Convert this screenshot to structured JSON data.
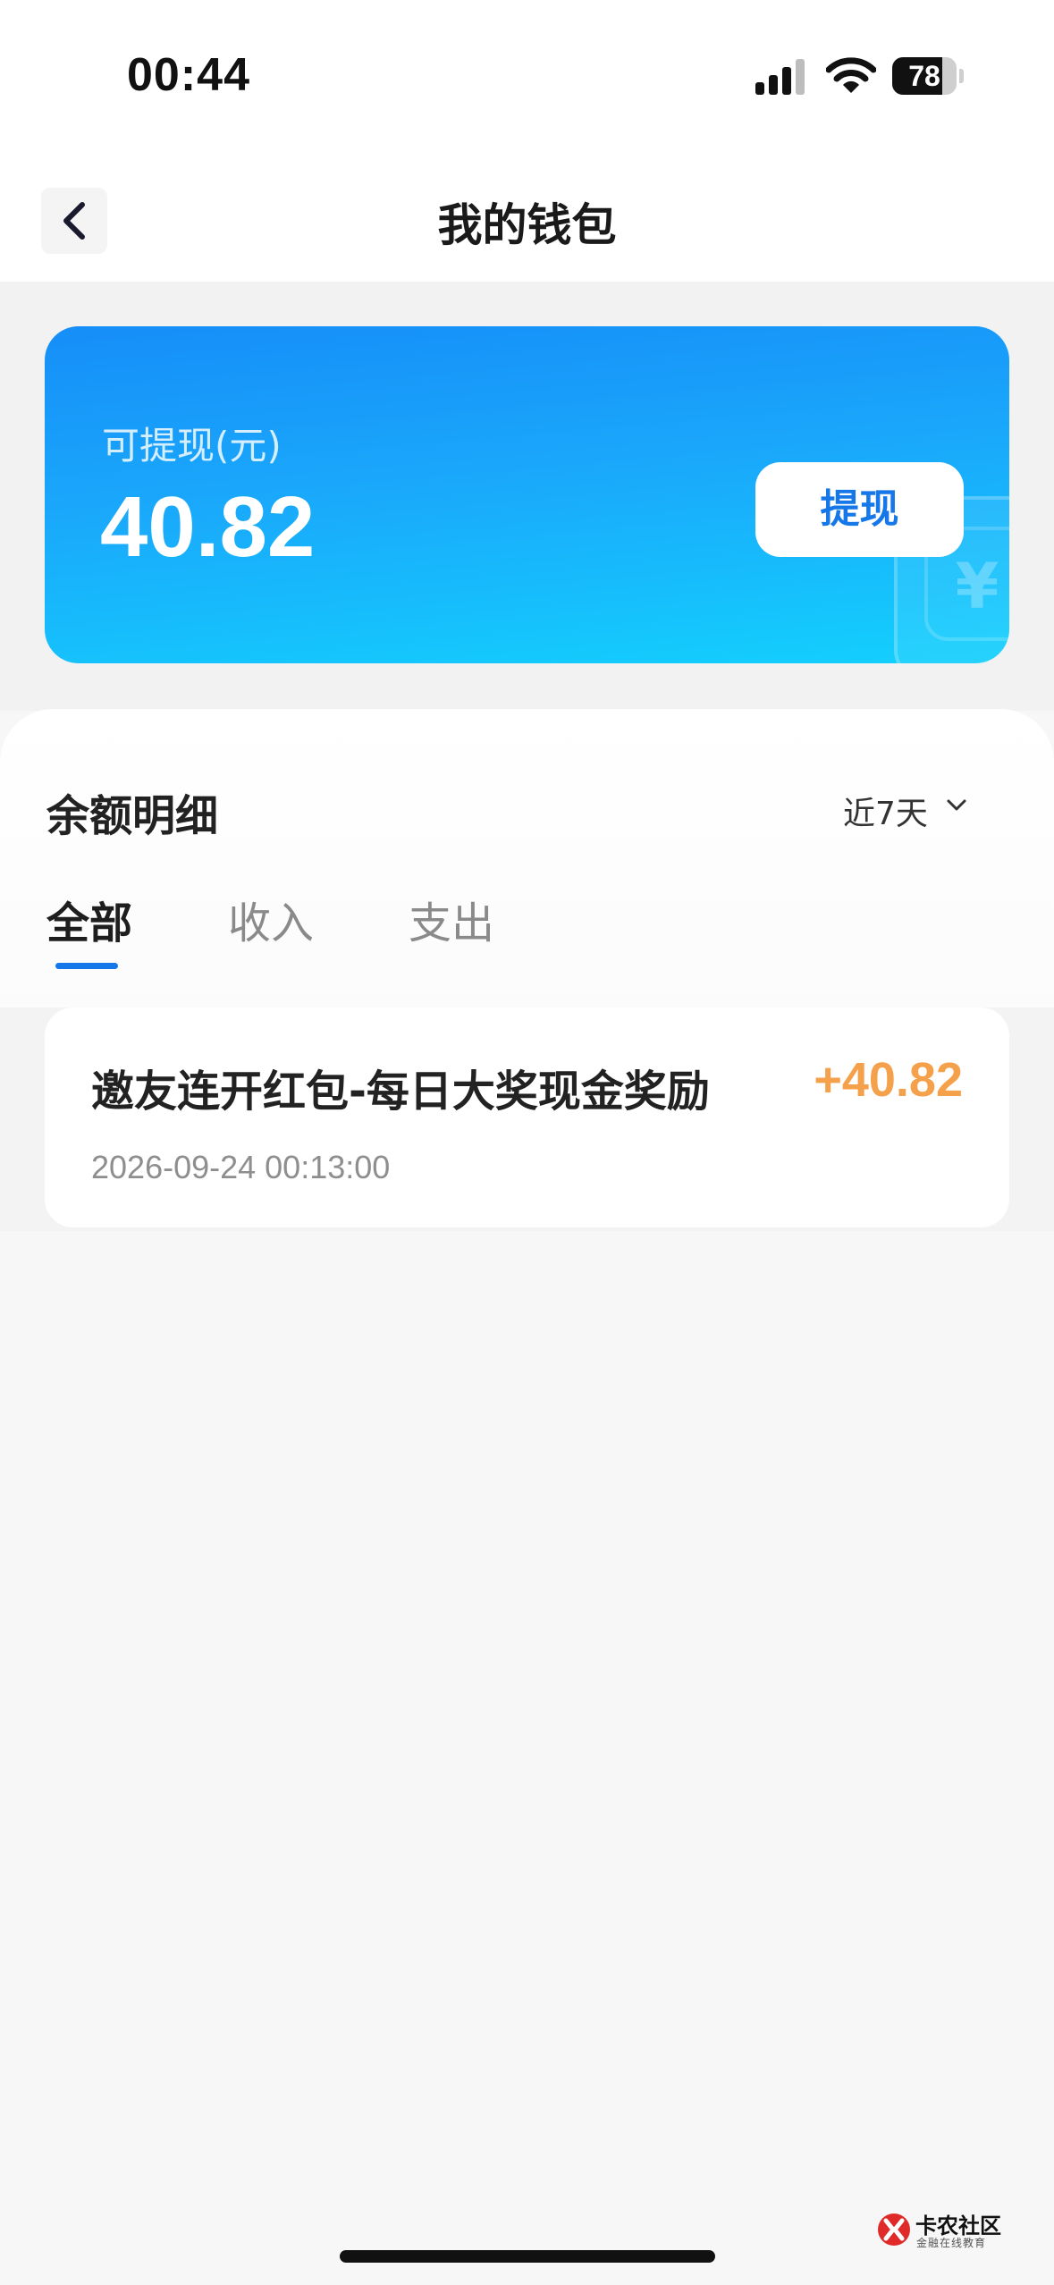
{
  "status_bar": {
    "time": "00:44",
    "battery": "78",
    "battery_level": 0.78
  },
  "nav": {
    "title": "我的钱包",
    "back_icon": "chevron-left-icon"
  },
  "balance_card": {
    "label": "可提现(元)",
    "amount": "40.82",
    "withdraw_label": "提现",
    "decoration_icon": "yen-shield-icon",
    "decoration_glyph": "¥"
  },
  "details": {
    "title": "余额明细",
    "range": "近7天",
    "tabs": [
      {
        "label": "全部",
        "active": true
      },
      {
        "label": "收入",
        "active": false
      },
      {
        "label": "支出",
        "active": false
      }
    ],
    "transactions": [
      {
        "title": "邀友连开红包-每日大奖现金奖励",
        "amount": "+40.82",
        "time": "2026-09-24 00:13:00"
      }
    ]
  },
  "watermark": {
    "title": "卡农社区",
    "subtitle": "金融在线教育"
  },
  "colors": {
    "accent": "#1677e8",
    "income": "#f5a04a",
    "card_gradient_start": "#168ef8",
    "card_gradient_end": "#13d0fd"
  }
}
